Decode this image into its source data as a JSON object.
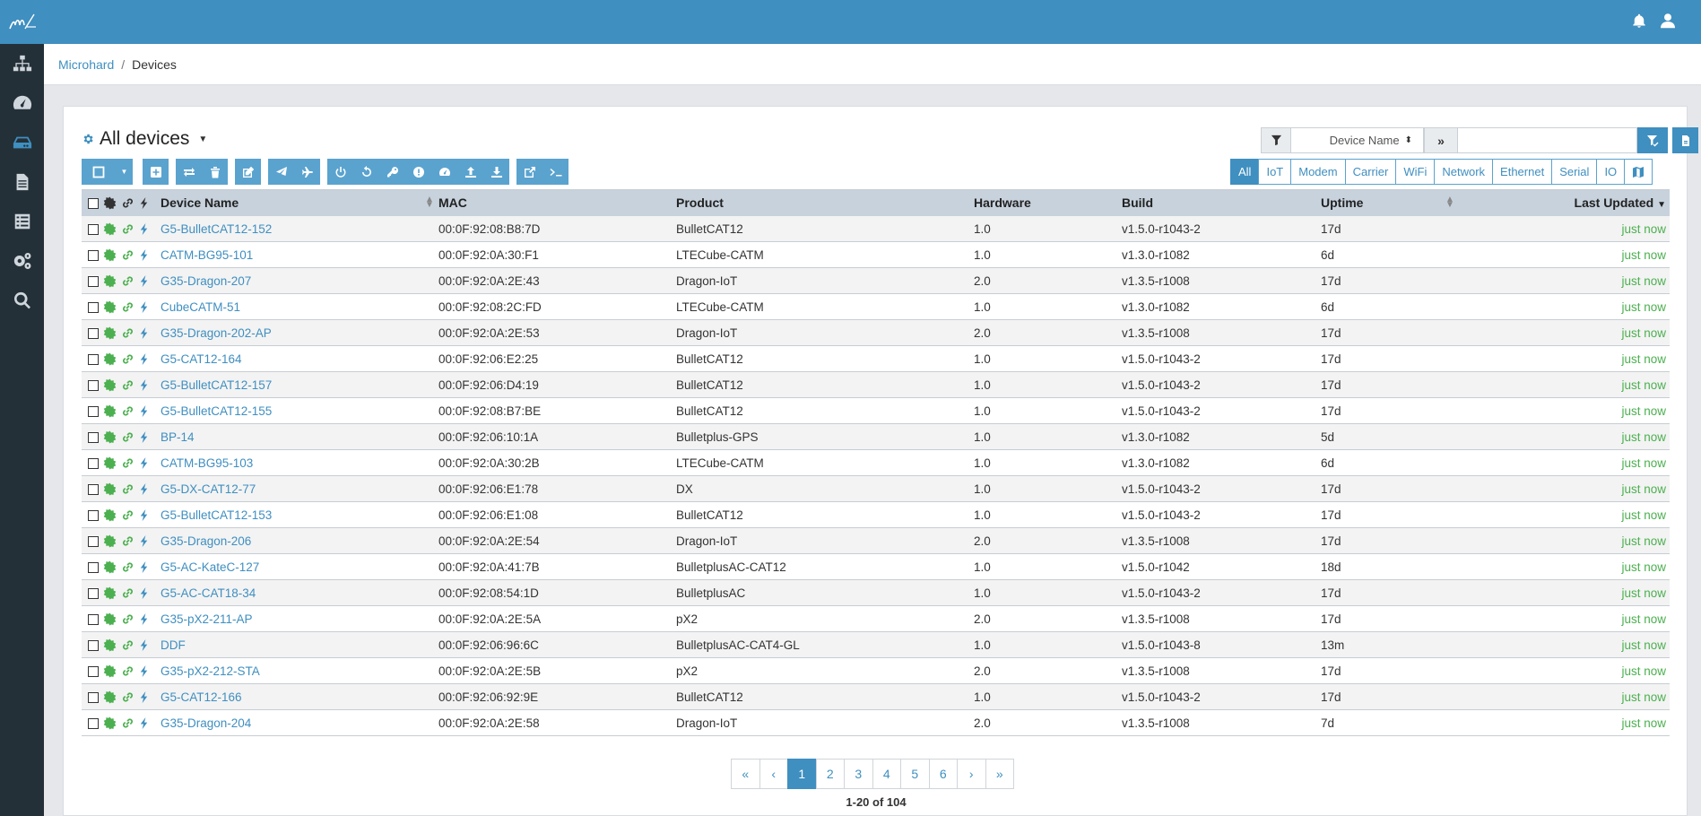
{
  "header": {
    "logo_text": "m",
    "icons": [
      "bell-icon",
      "user-icon"
    ]
  },
  "sidebar": {
    "items": [
      {
        "name": "network-topology-icon",
        "active": false
      },
      {
        "name": "dashboard-gauge-icon",
        "active": false
      },
      {
        "name": "devices-icon",
        "active": true
      },
      {
        "name": "document-icon",
        "active": false
      },
      {
        "name": "list-icon",
        "active": false
      },
      {
        "name": "settings-cogs-icon",
        "active": false
      },
      {
        "name": "search-icon",
        "active": false
      }
    ]
  },
  "breadcrumb": {
    "root": "Microhard",
    "separator": "/",
    "current": "Devices"
  },
  "card": {
    "title": "All devices"
  },
  "filter": {
    "field_select": "Device Name",
    "search_value": ""
  },
  "categories": [
    {
      "label": "All",
      "active": true
    },
    {
      "label": "IoT",
      "active": false
    },
    {
      "label": "Modem",
      "active": false
    },
    {
      "label": "Carrier",
      "active": false
    },
    {
      "label": "WiFi",
      "active": false
    },
    {
      "label": "Network",
      "active": false
    },
    {
      "label": "Ethernet",
      "active": false
    },
    {
      "label": "Serial",
      "active": false
    },
    {
      "label": "IO",
      "active": false
    }
  ],
  "table": {
    "columns": {
      "name": "Device Name",
      "mac": "MAC",
      "product": "Product",
      "hardware": "Hardware",
      "build": "Build",
      "uptime": "Uptime",
      "updated": "Last Updated"
    },
    "rows": [
      {
        "name": "G5-BulletCAT12-152",
        "mac": "00:0F:92:08:B8:7D",
        "product": "BulletCAT12",
        "hardware": "1.0",
        "build": "v1.5.0-r1043-2",
        "uptime": "17d",
        "updated": "just now"
      },
      {
        "name": "CATM-BG95-101",
        "mac": "00:0F:92:0A:30:F1",
        "product": "LTECube-CATM",
        "hardware": "1.0",
        "build": "v1.3.0-r1082",
        "uptime": "6d",
        "updated": "just now"
      },
      {
        "name": "G35-Dragon-207",
        "mac": "00:0F:92:0A:2E:43",
        "product": "Dragon-IoT",
        "hardware": "2.0",
        "build": "v1.3.5-r1008",
        "uptime": "17d",
        "updated": "just now"
      },
      {
        "name": "CubeCATM-51",
        "mac": "00:0F:92:08:2C:FD",
        "product": "LTECube-CATM",
        "hardware": "1.0",
        "build": "v1.3.0-r1082",
        "uptime": "6d",
        "updated": "just now"
      },
      {
        "name": "G35-Dragon-202-AP",
        "mac": "00:0F:92:0A:2E:53",
        "product": "Dragon-IoT",
        "hardware": "2.0",
        "build": "v1.3.5-r1008",
        "uptime": "17d",
        "updated": "just now"
      },
      {
        "name": "G5-CAT12-164",
        "mac": "00:0F:92:06:E2:25",
        "product": "BulletCAT12",
        "hardware": "1.0",
        "build": "v1.5.0-r1043-2",
        "uptime": "17d",
        "updated": "just now"
      },
      {
        "name": "G5-BulletCAT12-157",
        "mac": "00:0F:92:06:D4:19",
        "product": "BulletCAT12",
        "hardware": "1.0",
        "build": "v1.5.0-r1043-2",
        "uptime": "17d",
        "updated": "just now"
      },
      {
        "name": "G5-BulletCAT12-155",
        "mac": "00:0F:92:08:B7:BE",
        "product": "BulletCAT12",
        "hardware": "1.0",
        "build": "v1.5.0-r1043-2",
        "uptime": "17d",
        "updated": "just now"
      },
      {
        "name": "BP-14",
        "mac": "00:0F:92:06:10:1A",
        "product": "Bulletplus-GPS",
        "hardware": "1.0",
        "build": "v1.3.0-r1082",
        "uptime": "5d",
        "updated": "just now"
      },
      {
        "name": "CATM-BG95-103",
        "mac": "00:0F:92:0A:30:2B",
        "product": "LTECube-CATM",
        "hardware": "1.0",
        "build": "v1.3.0-r1082",
        "uptime": "6d",
        "updated": "just now"
      },
      {
        "name": "G5-DX-CAT12-77",
        "mac": "00:0F:92:06:E1:78",
        "product": "DX",
        "hardware": "1.0",
        "build": "v1.5.0-r1043-2",
        "uptime": "17d",
        "updated": "just now"
      },
      {
        "name": "G5-BulletCAT12-153",
        "mac": "00:0F:92:06:E1:08",
        "product": "BulletCAT12",
        "hardware": "1.0",
        "build": "v1.5.0-r1043-2",
        "uptime": "17d",
        "updated": "just now"
      },
      {
        "name": "G35-Dragon-206",
        "mac": "00:0F:92:0A:2E:54",
        "product": "Dragon-IoT",
        "hardware": "2.0",
        "build": "v1.3.5-r1008",
        "uptime": "17d",
        "updated": "just now"
      },
      {
        "name": "G5-AC-KateC-127",
        "mac": "00:0F:92:0A:41:7B",
        "product": "BulletplusAC-CAT12",
        "hardware": "1.0",
        "build": "v1.5.0-r1042",
        "uptime": "18d",
        "updated": "just now"
      },
      {
        "name": "G5-AC-CAT18-34",
        "mac": "00:0F:92:08:54:1D",
        "product": "BulletplusAC",
        "hardware": "1.0",
        "build": "v1.5.0-r1043-2",
        "uptime": "17d",
        "updated": "just now"
      },
      {
        "name": "G35-pX2-211-AP",
        "mac": "00:0F:92:0A:2E:5A",
        "product": "pX2",
        "hardware": "2.0",
        "build": "v1.3.5-r1008",
        "uptime": "17d",
        "updated": "just now"
      },
      {
        "name": "DDF",
        "mac": "00:0F:92:06:96:6C",
        "product": "BulletplusAC-CAT4-GL",
        "hardware": "1.0",
        "build": "v1.5.0-r1043-8",
        "uptime": "13m",
        "updated": "just now"
      },
      {
        "name": "G35-pX2-212-STA",
        "mac": "00:0F:92:0A:2E:5B",
        "product": "pX2",
        "hardware": "2.0",
        "build": "v1.3.5-r1008",
        "uptime": "17d",
        "updated": "just now"
      },
      {
        "name": "G5-CAT12-166",
        "mac": "00:0F:92:06:92:9E",
        "product": "BulletCAT12",
        "hardware": "1.0",
        "build": "v1.5.0-r1043-2",
        "uptime": "17d",
        "updated": "just now"
      },
      {
        "name": "G35-Dragon-204",
        "mac": "00:0F:92:0A:2E:58",
        "product": "Dragon-IoT",
        "hardware": "2.0",
        "build": "v1.3.5-r1008",
        "uptime": "7d",
        "updated": "just now"
      }
    ]
  },
  "pagination": {
    "first": "«",
    "prev": "‹",
    "pages": [
      "1",
      "2",
      "3",
      "4",
      "5",
      "6"
    ],
    "current": "1",
    "next": "›",
    "last": "»",
    "range_text": "1-20 of 104"
  },
  "colors": {
    "primary": "#3f8fc0",
    "button": "#5aa3cf",
    "sidebar": "#243038",
    "status_green": "#4cb050",
    "header_row": "#c7d2dd"
  }
}
